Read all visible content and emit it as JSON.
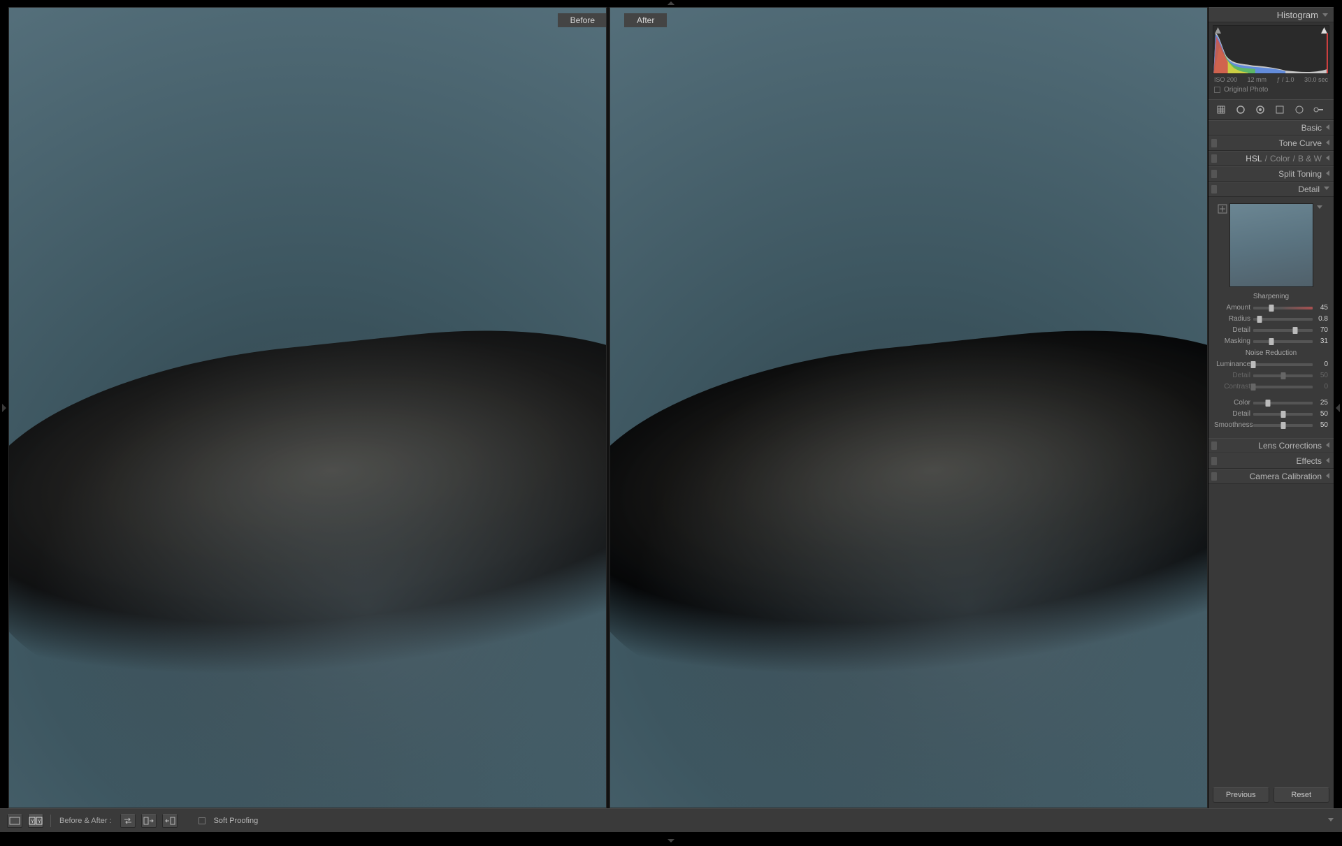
{
  "viewer": {
    "before_label": "Before",
    "after_label": "After"
  },
  "right": {
    "histogram_title": "Histogram",
    "meta": {
      "iso": "ISO 200",
      "focal": "12 mm",
      "aperture": "ƒ / 1.0",
      "shutter": "30.0 sec"
    },
    "original_photo": "Original Photo",
    "panels": {
      "basic": "Basic",
      "tone_curve": "Tone Curve",
      "hsl": "HSL",
      "color": "Color",
      "bw": "B & W",
      "split_toning": "Split Toning",
      "detail": "Detail",
      "lens": "Lens Corrections",
      "effects": "Effects",
      "calibration": "Camera Calibration"
    },
    "detail": {
      "sharpening_title": "Sharpening",
      "amount_label": "Amount",
      "amount_value": "45",
      "radius_label": "Radius",
      "radius_value": "0.8",
      "detail_label": "Detail",
      "detail_value": "70",
      "masking_label": "Masking",
      "masking_value": "31",
      "noise_title": "Noise Reduction",
      "luminance_label": "Luminance",
      "luminance_value": "0",
      "ldetail_label": "Detail",
      "ldetail_value": "50",
      "contrast_label": "Contrast",
      "contrast_value": "0",
      "color_label": "Color",
      "color_value": "25",
      "cdetail_label": "Detail",
      "cdetail_value": "50",
      "smooth_label": "Smoothness",
      "smooth_value": "50"
    },
    "buttons": {
      "previous": "Previous",
      "reset": "Reset"
    }
  },
  "bottom": {
    "before_after": "Before & After :",
    "soft_proof": "Soft Proofing"
  }
}
